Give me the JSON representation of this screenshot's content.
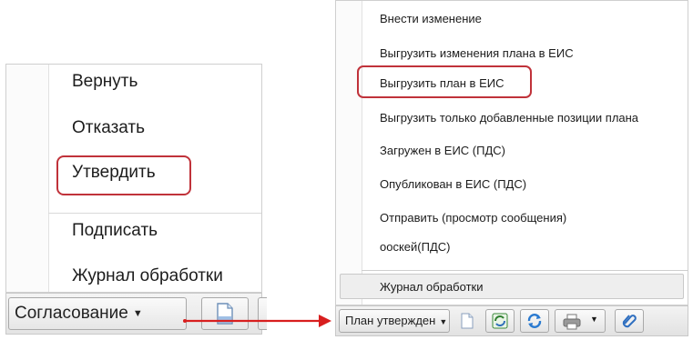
{
  "left_panel": {
    "menu_items": [
      "Вернуть",
      "Отказать",
      "Утвердить",
      "Подписать",
      "Журнал обработки"
    ],
    "highlighted_item": "Утвердить",
    "toolbar": {
      "status_button_label": "Согласование"
    }
  },
  "right_panel": {
    "menu_items": [
      "Внести изменение",
      "Выгрузить изменения плана в ЕИС",
      "Выгрузить план в ЕИС",
      "Выгрузить только добавленные позиции плана",
      "Загружен в ЕИС (ПДС)",
      "Опубликован в ЕИС (ПДС)",
      "Отправить (просмотр сообщения)",
      "оoскей(ПДС)"
    ],
    "footer_item": "Журнал обработки",
    "highlighted_item": "Выгрузить план в ЕИС",
    "toolbar": {
      "status_button_label": "План утвержден",
      "icons": [
        "document-icon",
        "excel-refresh-icon",
        "refresh-icon",
        "print-icon",
        "attach-icon"
      ]
    }
  },
  "colors": {
    "highlight": "#c0323a",
    "arrow": "#d81e1e"
  }
}
